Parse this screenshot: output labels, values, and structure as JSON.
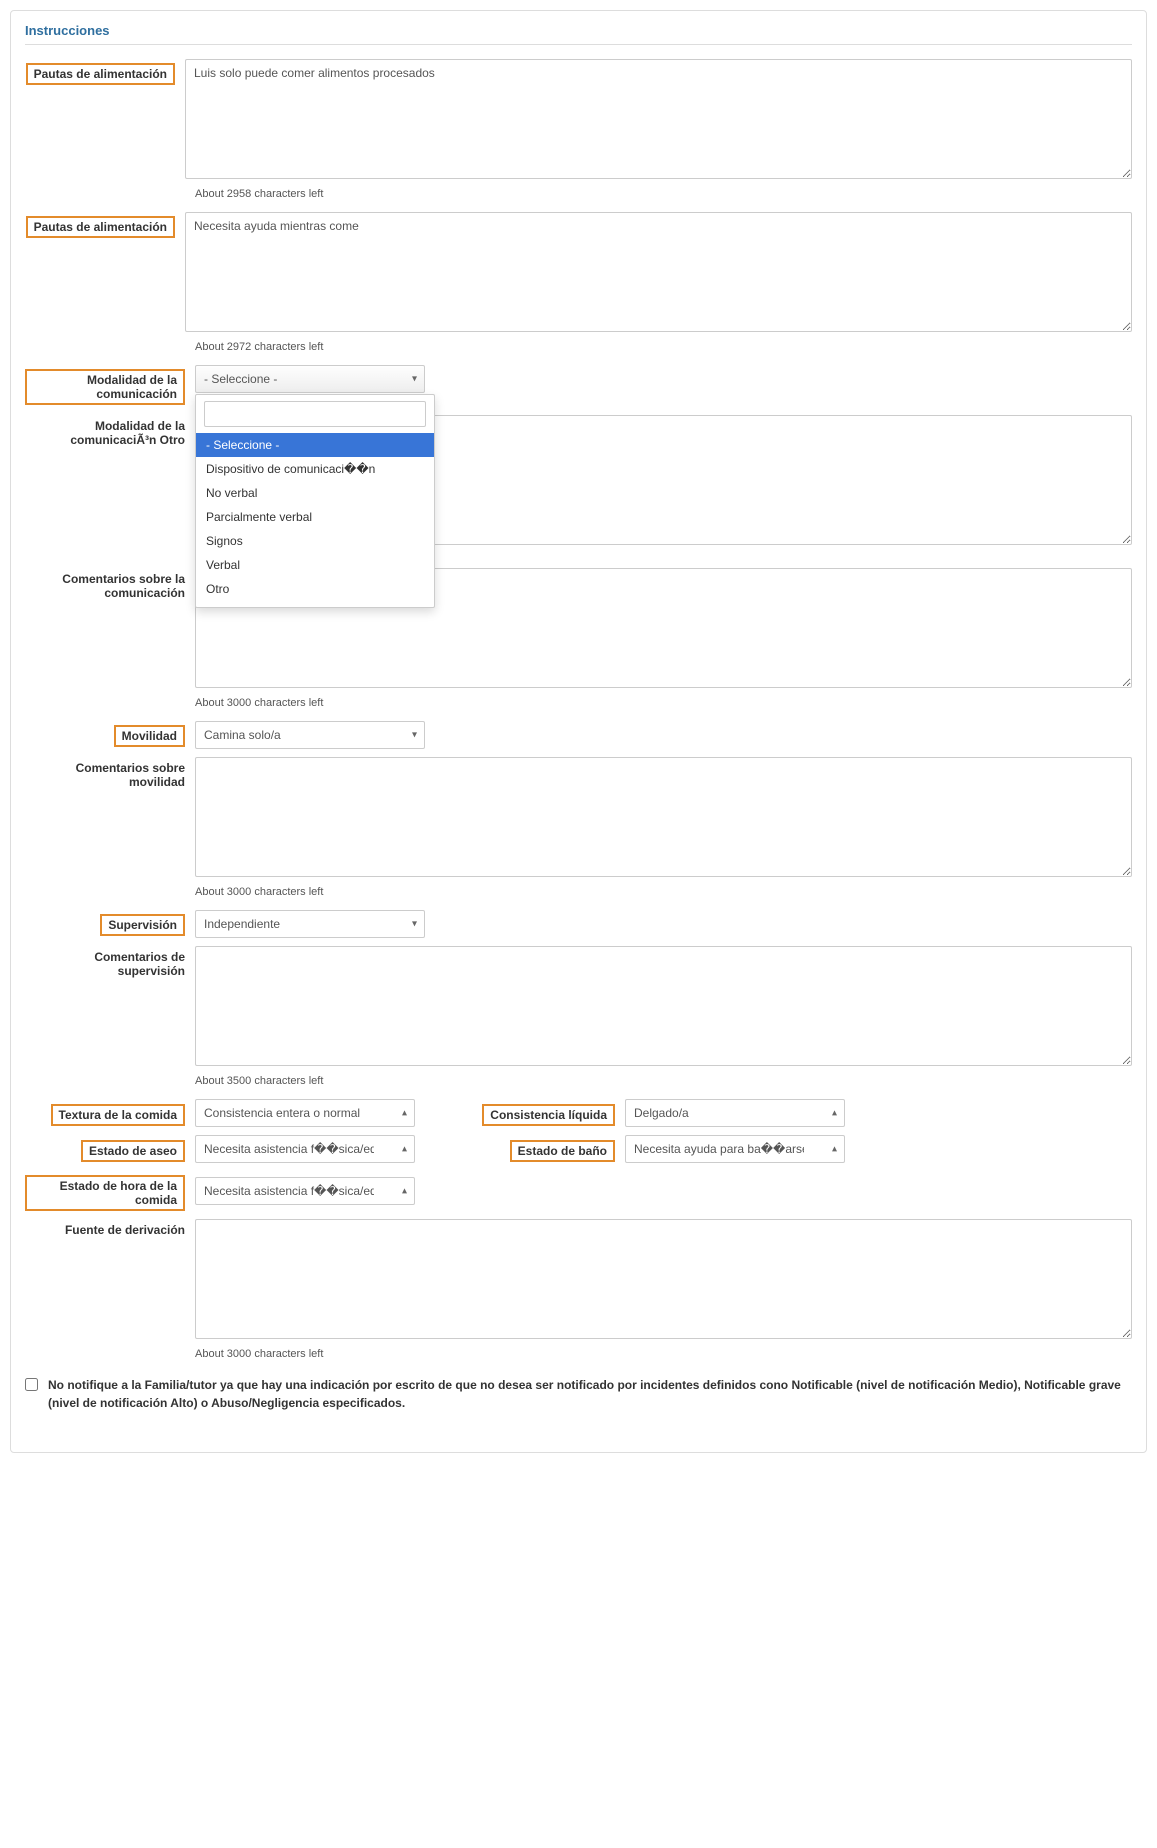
{
  "section": {
    "title": "Instrucciones"
  },
  "fields": {
    "dietary1": {
      "label": "Pautas de alimentación",
      "value": "Luis solo puede comer alimentos procesados",
      "counter": "About 2958 characters left"
    },
    "dietary2": {
      "label": "Pautas de alimentación",
      "value": "Necesita ayuda mientras come",
      "counter": "About 2972 characters left"
    },
    "comm_mode": {
      "label": "Modalidad de la comunicación",
      "selected": "- Seleccione -"
    },
    "comm_mode_options": [
      "- Seleccione -",
      "Dispositivo de comunicaci��n",
      "No verbal",
      "Parcialmente verbal",
      "Signos",
      "Verbal",
      "Otro"
    ],
    "comm_mode_other": {
      "label": "Modalidad de la comunicaciÃ³n Otro"
    },
    "comm_comments": {
      "label": "Comentarios sobre la comunicación",
      "counter": "About 3000 characters left"
    },
    "mobility": {
      "label": "Movilidad",
      "selected": "Camina solo/a"
    },
    "mobility_comments": {
      "label": "Comentarios sobre movilidad",
      "counter": "About 3000 characters left"
    },
    "supervision": {
      "label": "Supervisión",
      "selected": "Independiente"
    },
    "supervision_comments": {
      "label": "Comentarios de supervisión",
      "counter": "About 3500 characters left"
    },
    "food_texture": {
      "label": "Textura de la comida",
      "selected": "Consistencia entera o normal"
    },
    "liquid": {
      "label": "Consistencia líquida",
      "selected": "Delgado/a"
    },
    "toileting": {
      "label": "Estado de aseo",
      "selected": "Necesita asistencia f��sica/equipo"
    },
    "bathing": {
      "label": "Estado de baño",
      "selected": "Necesita ayuda para ba��arse/ducharse"
    },
    "mealtime": {
      "label": "Estado de hora de la comida",
      "selected": "Necesita asistencia f��sica/equipo"
    },
    "referral": {
      "label": "Fuente de derivación",
      "counter": "About 3000 characters left"
    },
    "checkbox": {
      "label": "No notifique a la Familia/tutor ya que hay una indicación por escrito de que no desea ser notificado por incidentes definidos cono Notificable (nivel de notificación Medio), Notificable grave (nivel de notificación Alto) o Abuso/Negligencia especificados."
    }
  }
}
